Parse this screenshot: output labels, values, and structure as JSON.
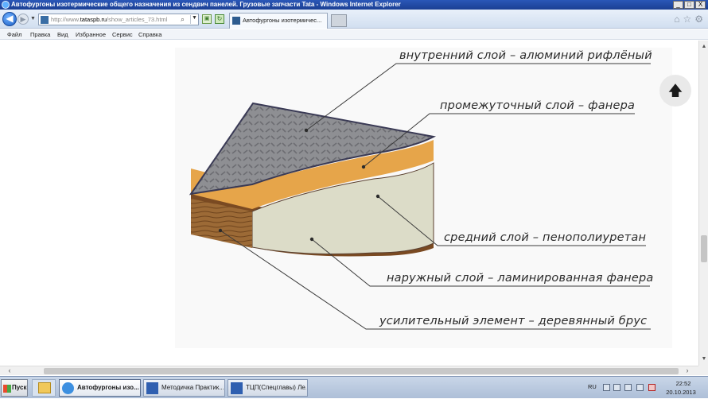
{
  "window": {
    "title": "Автофургоны изотермические общего назначения из сендвич панелей. Грузовые запчасти Tata - Windows Internet Explorer",
    "minimize_glyph": "_",
    "maximize_glyph": "□",
    "close_glyph": "X"
  },
  "navbar": {
    "url_prefix": "http://www.",
    "url_domain": "tataspb.ru",
    "url_path": "/show_articles_73.html",
    "tab_label": "Автофургоны изотермичес...",
    "back_glyph": "◀",
    "forward_glyph": "▶",
    "right_icons": [
      "⌂",
      "☆",
      "⚙"
    ]
  },
  "menu": {
    "items": [
      "Файл",
      "Правка",
      "Вид",
      "Избранное",
      "Сервис",
      "Справка"
    ]
  },
  "figure": {
    "callouts": [
      "внутренний слой – алюминий рифлёный",
      "промежуточный слой – фанера",
      "средний слой – пенополиуретан",
      "наружный слой – ламинированная фанера",
      "усилительный элемент – деревянный брус"
    ],
    "colors": {
      "aluminium": "#8e8f93",
      "plywood": "#e6a54a",
      "foam": "#dcdcc8",
      "laminate": "#7a4a22",
      "beam": "#9c6a36"
    }
  },
  "scroll_to_top": {
    "glyph": "🡅"
  },
  "taskbar": {
    "start_label": "Пуск",
    "tasks": [
      {
        "label": "Автофургоны изо...",
        "active": true,
        "icon": "ie-icon"
      },
      {
        "label": "Методичка Практик...",
        "active": false,
        "icon": "word-document-icon"
      },
      {
        "label": "ТЦП(Спецглавы) Ле...",
        "active": false,
        "icon": "word-document-icon"
      }
    ],
    "tray": {
      "language": "RU",
      "time": "22:52",
      "date": "20.10.2013"
    }
  }
}
